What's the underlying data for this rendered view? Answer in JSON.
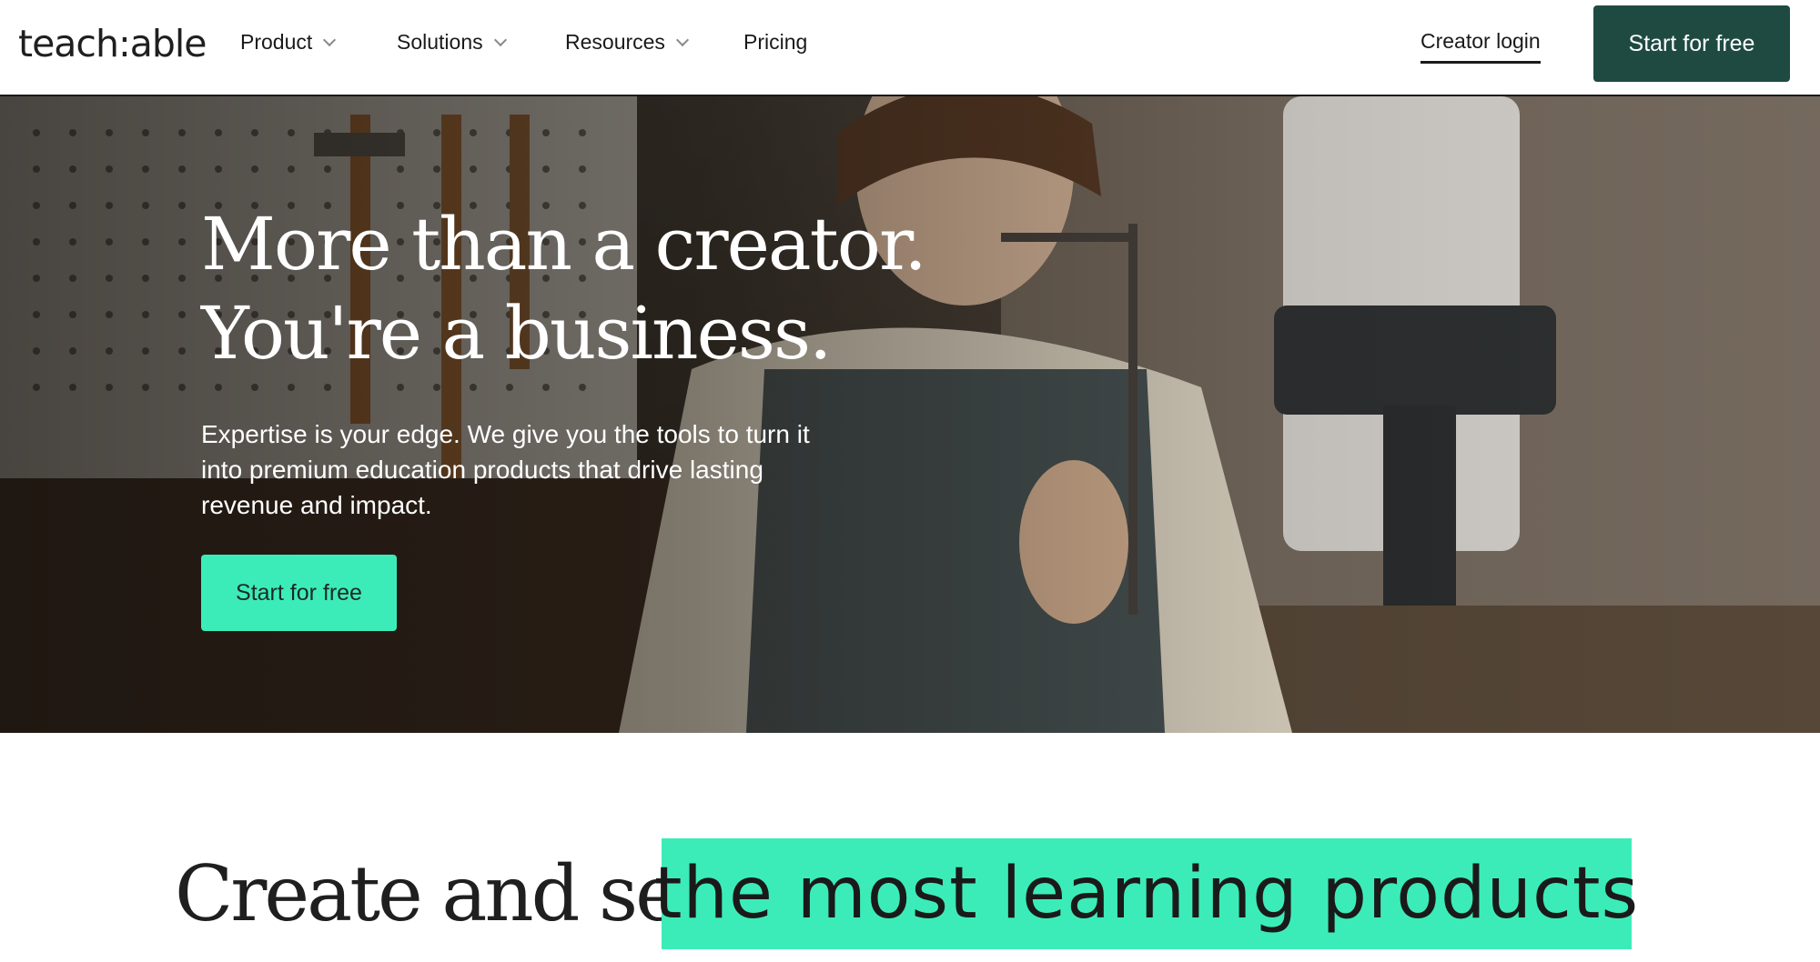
{
  "nav": {
    "logo": "teach:able",
    "items": [
      {
        "label": "Product",
        "has_dropdown": true
      },
      {
        "label": "Solutions",
        "has_dropdown": true
      },
      {
        "label": "Resources",
        "has_dropdown": true
      },
      {
        "label": "Pricing",
        "has_dropdown": false
      }
    ],
    "creator_login": "Creator login",
    "cta": "Start for free"
  },
  "hero": {
    "title_line1": "More than a creator.",
    "title_line2": "You're a business.",
    "subtitle": "Expertise is your edge. We give you the tools to turn it into premium education products that drive lasting revenue and impact.",
    "cta": "Start for free",
    "image_description_icon": "hero-photo"
  },
  "headline": {
    "lead": "Create and sell",
    "highlight": "the most learning products"
  },
  "colors": {
    "brand_dark": "#1e4a42",
    "accent_mint": "#3cecb8",
    "text": "#1a1a1a"
  }
}
